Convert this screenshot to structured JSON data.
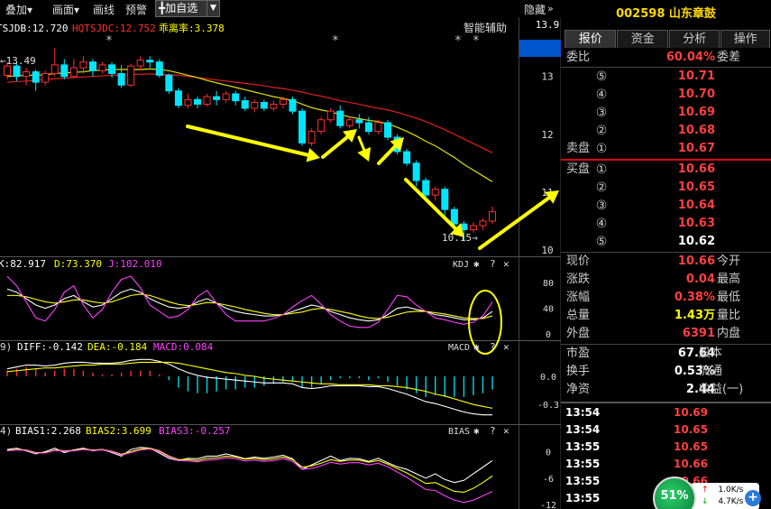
{
  "toolbar": {
    "items": [
      "叠加▾",
      "画面▾",
      "画线",
      "预警"
    ],
    "add_label": "╋加自选",
    "add_dropdown_icon": "▼",
    "hide_label": "隐藏",
    "collapse_icon": "»"
  },
  "main_chart": {
    "legend": [
      {
        "text": "TSJDB:12.720",
        "color": "#ffffff"
      },
      {
        "text": "HQTSJDC:12.752",
        "color": "#ff3030"
      },
      {
        "text": "乖离率:3.378",
        "color": "#ffff00"
      }
    ],
    "assist_label": "智能辅助",
    "star_marks": [
      "*",
      "*",
      "*",
      "*",
      "*"
    ],
    "high_label": "←13.49",
    "low_label": "10.15→",
    "y_ticks": [
      "13.9",
      "13",
      "12",
      "11",
      "10"
    ]
  },
  "chart_data": [
    {
      "type": "candlestick",
      "title": "",
      "ylim": [
        10,
        13.9
      ],
      "candles": [
        [
          13.02,
          13.18,
          12.95,
          13.25
        ],
        [
          13.18,
          13.0,
          12.92,
          13.24
        ],
        [
          13.0,
          13.08,
          12.85,
          13.15
        ],
        [
          13.08,
          12.9,
          12.75,
          13.12
        ],
        [
          12.9,
          13.05,
          12.85,
          13.1
        ],
        [
          13.05,
          13.2,
          13.0,
          13.49
        ],
        [
          13.2,
          13.0,
          12.95,
          13.3
        ],
        [
          13.0,
          13.15,
          12.98,
          13.3
        ],
        [
          13.15,
          13.25,
          13.05,
          13.35
        ],
        [
          13.25,
          13.1,
          13.0,
          13.3
        ],
        [
          13.1,
          13.2,
          13.05,
          13.25
        ],
        [
          13.2,
          13.05,
          12.98,
          13.25
        ],
        [
          13.05,
          12.85,
          12.8,
          13.2
        ],
        [
          12.85,
          13.18,
          12.82,
          13.22
        ],
        [
          13.18,
          13.28,
          13.1,
          13.35
        ],
        [
          13.28,
          13.25,
          13.15,
          13.35
        ],
        [
          13.25,
          13.02,
          12.98,
          13.3
        ],
        [
          13.02,
          12.75,
          12.7,
          13.05
        ],
        [
          12.75,
          12.5,
          12.45,
          12.8
        ],
        [
          12.5,
          12.6,
          12.45,
          12.7
        ],
        [
          12.6,
          12.52,
          12.45,
          12.65
        ],
        [
          12.52,
          12.65,
          12.48,
          12.7
        ],
        [
          12.65,
          12.6,
          12.5,
          12.75
        ],
        [
          12.6,
          12.7,
          12.55,
          12.75
        ],
        [
          12.7,
          12.58,
          12.5,
          12.75
        ],
        [
          12.58,
          12.45,
          12.4,
          12.65
        ],
        [
          12.45,
          12.55,
          12.38,
          12.6
        ],
        [
          12.55,
          12.45,
          12.4,
          12.6
        ],
        [
          12.45,
          12.52,
          12.4,
          12.58
        ],
        [
          12.52,
          12.6,
          12.45,
          12.65
        ],
        [
          12.6,
          12.4,
          12.35,
          12.65
        ],
        [
          12.4,
          11.85,
          11.8,
          12.45
        ],
        [
          11.85,
          12.05,
          11.8,
          12.1
        ],
        [
          12.05,
          12.25,
          12.0,
          12.3
        ],
        [
          12.25,
          12.4,
          12.2,
          12.45
        ],
        [
          12.4,
          12.15,
          12.1,
          12.5
        ],
        [
          12.15,
          12.25,
          12.1,
          12.3
        ],
        [
          12.25,
          12.2,
          12.1,
          12.35
        ],
        [
          12.2,
          12.05,
          12.0,
          12.3
        ],
        [
          12.05,
          12.2,
          12.0,
          12.25
        ],
        [
          12.2,
          11.95,
          11.9,
          12.25
        ],
        [
          11.95,
          11.7,
          11.65,
          12.0
        ],
        [
          11.7,
          11.5,
          11.45,
          11.75
        ],
        [
          11.5,
          11.2,
          11.1,
          11.55
        ],
        [
          11.2,
          10.95,
          10.9,
          11.25
        ],
        [
          10.95,
          11.05,
          10.85,
          11.1
        ],
        [
          11.05,
          10.7,
          10.6,
          11.1
        ],
        [
          10.7,
          10.45,
          10.4,
          10.75
        ],
        [
          10.45,
          10.35,
          10.15,
          10.5
        ],
        [
          10.35,
          10.42,
          10.3,
          10.48
        ],
        [
          10.42,
          10.5,
          10.35,
          10.55
        ],
        [
          10.5,
          10.66,
          10.45,
          10.75
        ]
      ],
      "ma_yellow": [
        13.0,
        13.01,
        13.02,
        13.02,
        13.03,
        13.05,
        13.06,
        13.07,
        13.08,
        13.1,
        13.11,
        13.12,
        13.12,
        13.12,
        13.12,
        13.13,
        13.12,
        13.1,
        13.06,
        13.02,
        12.98,
        12.93,
        12.89,
        12.85,
        12.81,
        12.77,
        12.73,
        12.69,
        12.65,
        12.62,
        12.58,
        12.52,
        12.46,
        12.42,
        12.39,
        12.34,
        12.3,
        12.27,
        12.24,
        12.22,
        12.18,
        12.12,
        12.05,
        11.97,
        11.88,
        11.8,
        11.7,
        11.6,
        11.48,
        11.38,
        11.28,
        11.18
      ],
      "ma_red": [
        12.9,
        12.91,
        12.92,
        12.93,
        12.95,
        12.96,
        12.97,
        12.98,
        12.99,
        13.0,
        13.01,
        13.02,
        13.02,
        13.03,
        13.04,
        13.04,
        13.04,
        13.03,
        13.02,
        13.0,
        12.98,
        12.96,
        12.94,
        12.92,
        12.9,
        12.88,
        12.86,
        12.84,
        12.81,
        12.79,
        12.76,
        12.73,
        12.69,
        12.66,
        12.62,
        12.58,
        12.55,
        12.52,
        12.48,
        12.45,
        12.42,
        12.38,
        12.33,
        12.28,
        12.22,
        12.15,
        12.08,
        12.0,
        11.92,
        11.84,
        11.76,
        11.68
      ]
    },
    {
      "type": "line",
      "title": "KDJ",
      "ylim": [
        -10,
        100
      ],
      "series": [
        {
          "name": "K:82.917",
          "color": "#ffffff",
          "values": [
            70,
            65,
            55,
            45,
            40,
            45,
            55,
            60,
            50,
            42,
            45,
            55,
            65,
            70,
            65,
            55,
            48,
            42,
            40,
            42,
            50,
            55,
            48,
            40,
            35,
            32,
            30,
            28,
            28,
            30,
            35,
            40,
            45,
            42,
            35,
            30,
            25,
            22,
            20,
            22,
            30,
            40,
            42,
            38,
            35,
            30,
            28,
            25,
            22,
            22,
            25,
            35
          ]
        },
        {
          "name": "D:73.370",
          "color": "#ffff00",
          "values": [
            60,
            60,
            58,
            54,
            50,
            48,
            50,
            53,
            53,
            50,
            48,
            50,
            55,
            60,
            62,
            60,
            55,
            50,
            46,
            44,
            46,
            49,
            48,
            45,
            42,
            38,
            35,
            32,
            30,
            30,
            32,
            34,
            38,
            40,
            38,
            35,
            32,
            28,
            25,
            24,
            26,
            30,
            34,
            35,
            35,
            33,
            31,
            28,
            25,
            24,
            24,
            28
          ]
        },
        {
          "name": "J:102.010",
          "color": "#ff40ff",
          "values": [
            90,
            75,
            50,
            25,
            20,
            38,
            65,
            75,
            45,
            25,
            38,
            65,
            85,
            90,
            72,
            45,
            35,
            25,
            28,
            38,
            58,
            68,
            48,
            30,
            20,
            20,
            20,
            20,
            24,
            30,
            42,
            52,
            60,
            46,
            30,
            20,
            12,
            10,
            10,
            18,
            38,
            60,
            58,
            45,
            35,
            25,
            22,
            18,
            15,
            18,
            28,
            50
          ]
        }
      ],
      "y_ticks": [
        "80",
        "40",
        "0"
      ]
    },
    {
      "type": "line",
      "title": "MACD",
      "ylim": [
        -0.5,
        0.25
      ],
      "series": [
        {
          "name": "DIFF:-0.142",
          "color": "#ffffff",
          "values": [
            0.08,
            0.1,
            0.12,
            0.12,
            0.11,
            0.12,
            0.14,
            0.15,
            0.15,
            0.14,
            0.14,
            0.14,
            0.15,
            0.17,
            0.18,
            0.18,
            0.16,
            0.13,
            0.08,
            0.04,
            0.01,
            -0.01,
            -0.02,
            -0.03,
            -0.04,
            -0.05,
            -0.06,
            -0.07,
            -0.07,
            -0.07,
            -0.08,
            -0.12,
            -0.13,
            -0.12,
            -0.1,
            -0.1,
            -0.1,
            -0.1,
            -0.11,
            -0.11,
            -0.13,
            -0.16,
            -0.19,
            -0.23,
            -0.27,
            -0.29,
            -0.32,
            -0.35,
            -0.38,
            -0.4,
            -0.41,
            -0.41
          ]
        },
        {
          "name": "DEA:-0.184",
          "color": "#ffff00",
          "values": [
            0.05,
            0.06,
            0.07,
            0.08,
            0.09,
            0.09,
            0.1,
            0.11,
            0.12,
            0.12,
            0.13,
            0.13,
            0.13,
            0.14,
            0.15,
            0.15,
            0.15,
            0.15,
            0.14,
            0.12,
            0.1,
            0.08,
            0.06,
            0.04,
            0.03,
            0.01,
            0.0,
            -0.02,
            -0.03,
            -0.04,
            -0.05,
            -0.06,
            -0.07,
            -0.08,
            -0.08,
            -0.09,
            -0.09,
            -0.09,
            -0.09,
            -0.1,
            -0.1,
            -0.11,
            -0.12,
            -0.14,
            -0.16,
            -0.19,
            -0.21,
            -0.24,
            -0.27,
            -0.3,
            -0.32,
            -0.34
          ]
        }
      ],
      "macd_label": "MACD:0.084",
      "y_ticks": [
        "0.0",
        "-0.3"
      ]
    },
    {
      "type": "line",
      "title": "BIAS",
      "ylim": [
        -13,
        4
      ],
      "series": [
        {
          "name": "BIAS1:2.268",
          "color": "#ffffff",
          "values": [
            0.5,
            0.8,
            0.2,
            -0.5,
            0.0,
            0.8,
            -0.2,
            0.4,
            0.8,
            0.2,
            0.5,
            -0.2,
            -1.0,
            0.5,
            1.0,
            0.8,
            -0.3,
            -1.5,
            -2.0,
            -1.5,
            -1.6,
            -1.0,
            -1.0,
            -0.5,
            -1.0,
            -1.6,
            -1.2,
            -1.5,
            -1.2,
            -0.8,
            -1.6,
            -4.0,
            -3.0,
            -2.0,
            -1.0,
            -2.0,
            -1.5,
            -1.6,
            -2.2,
            -1.5,
            -2.5,
            -3.4,
            -4.0,
            -5.0,
            -6.0,
            -5.0,
            -6.3,
            -7.0,
            -6.5,
            -5.0,
            -3.5,
            -2.0
          ]
        },
        {
          "name": "BIAS2:3.699",
          "color": "#ffff00",
          "values": [
            0.3,
            0.5,
            0.4,
            -0.2,
            -0.2,
            0.4,
            0.2,
            0.3,
            0.6,
            0.4,
            0.5,
            0.1,
            -0.6,
            0.0,
            0.6,
            0.8,
            0.2,
            -1.0,
            -1.8,
            -1.8,
            -2.0,
            -1.5,
            -1.4,
            -1.0,
            -1.2,
            -1.7,
            -1.5,
            -1.8,
            -1.6,
            -1.2,
            -1.8,
            -3.5,
            -3.2,
            -2.6,
            -1.8,
            -2.2,
            -1.9,
            -1.9,
            -2.4,
            -2.0,
            -2.8,
            -3.8,
            -4.8,
            -6.0,
            -7.2,
            -7.0,
            -8.0,
            -9.0,
            -9.2,
            -8.3,
            -7.0,
            -5.5
          ]
        },
        {
          "name": "BIAS3:-0.257",
          "color": "#ff40ff",
          "values": [
            0.2,
            0.4,
            0.3,
            -0.3,
            -0.3,
            0.3,
            0.1,
            0.2,
            0.5,
            0.3,
            0.4,
            0.0,
            -0.8,
            -0.2,
            0.4,
            0.6,
            0.0,
            -1.2,
            -2.0,
            -2.1,
            -2.3,
            -1.9,
            -1.8,
            -1.4,
            -1.6,
            -2.1,
            -1.9,
            -2.2,
            -2.0,
            -1.6,
            -2.2,
            -4.0,
            -3.8,
            -3.2,
            -2.4,
            -2.8,
            -2.5,
            -2.5,
            -3.0,
            -2.6,
            -3.4,
            -4.6,
            -5.8,
            -7.2,
            -8.6,
            -8.8,
            -10.0,
            -11.0,
            -11.5,
            -11.0,
            -10.0,
            -9.0
          ]
        }
      ],
      "y_ticks": [
        "0",
        "-6",
        "-12"
      ]
    }
  ],
  "right_panel": {
    "stock_title": "002598 山东章鼓",
    "tabs": [
      "报价",
      "资金",
      "分析",
      "操作"
    ],
    "weibi": {
      "label": "委比",
      "value": "60.04%",
      "label2": "委差"
    },
    "sell": [
      {
        "label": "",
        "num": "⑤",
        "price": "10.71"
      },
      {
        "label": "",
        "num": "④",
        "price": "10.70"
      },
      {
        "label": "",
        "num": "③",
        "price": "10.69"
      },
      {
        "label": "",
        "num": "②",
        "price": "10.68"
      },
      {
        "label": "卖盘",
        "num": "①",
        "price": "10.67"
      }
    ],
    "buy": [
      {
        "label": "买盘",
        "num": "①",
        "price": "10.66"
      },
      {
        "label": "",
        "num": "②",
        "price": "10.65"
      },
      {
        "label": "",
        "num": "③",
        "price": "10.64"
      },
      {
        "label": "",
        "num": "④",
        "price": "10.63"
      },
      {
        "label": "",
        "num": "⑤",
        "price": "10.62"
      }
    ],
    "stats": [
      {
        "label": "现价",
        "value": "10.66",
        "color": "#ff4040",
        "label2": "今开"
      },
      {
        "label": "涨跌",
        "value": "0.04",
        "color": "#ff4040",
        "label2": "最高"
      },
      {
        "label": "涨幅",
        "value": "0.38%",
        "color": "#ff4040",
        "label2": "最低"
      },
      {
        "label": "总量",
        "value": "1.43万",
        "color": "#ffff00",
        "label2": "量比"
      },
      {
        "label": "外盘",
        "value": "6391",
        "color": "#ff4040",
        "label2": "内盘"
      }
    ],
    "stats2": [
      {
        "label": "市盈",
        "value": "67.64",
        "label2": "股本"
      },
      {
        "label": "换手",
        "value": "0.53%",
        "label2": "流通"
      },
      {
        "label": "净资",
        "value": "2.44",
        "label2": "收益(一)"
      }
    ],
    "trades": [
      {
        "time": "13:54",
        "price": "10.69"
      },
      {
        "time": "13:54",
        "price": "10.65"
      },
      {
        "time": "13:55",
        "price": "10.65"
      },
      {
        "time": "13:55",
        "price": "10.66"
      },
      {
        "time": "13:55",
        "price": "10.66"
      },
      {
        "time": "13:55",
        "price": ""
      }
    ],
    "speed": {
      "percent": "51%",
      "up": "1.0K/s",
      "down": "4.7K/s",
      "up_icon": "↑",
      "down_icon": "↓",
      "plus": "+"
    }
  },
  "indicator_headers": {
    "kdj": {
      "prefix": "",
      "name": "KDJ"
    },
    "macd": {
      "prefix": "9)",
      "name": "MACD"
    },
    "bias": {
      "prefix": "4)",
      "name": "BIAS"
    },
    "icons": {
      "gear": "✱",
      "help": "?",
      "close": "✕"
    }
  },
  "colors": {
    "up": "#ff3030",
    "down": "#00e5ff",
    "arrow": "#ffff00",
    "highlight_box": "#0055cc"
  }
}
